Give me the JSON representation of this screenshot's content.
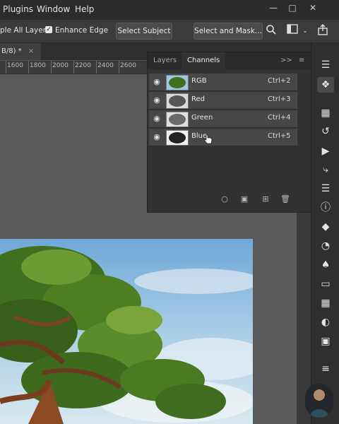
{
  "menubar": {
    "items": [
      "Plugins",
      "Window",
      "Help"
    ],
    "window_controls": [
      "minimize-icon",
      "maximize-icon",
      "close-icon"
    ]
  },
  "options_bar": {
    "sample_all_layers": "ple All Layers",
    "enhance_edge": "Enhance Edge",
    "enhance_edge_checked": true,
    "select_subject": "Select Subject",
    "select_and_mask": "Select and Mask...",
    "icons": [
      "search-icon",
      "workspace-icon",
      "chevron-down-icon",
      "share-icon"
    ]
  },
  "document_tab": {
    "label": "B/8) *",
    "close": "×"
  },
  "ruler": {
    "ticks": [
      "1600",
      "1800",
      "2000",
      "2200",
      "2400",
      "2600"
    ]
  },
  "panel": {
    "tabs": [
      "Layers",
      "Channels"
    ],
    "active_tab": "Channels",
    "collapse": ">>",
    "menu": "≡",
    "channels": [
      {
        "name": "RGB",
        "shortcut": "Ctrl+2"
      },
      {
        "name": "Red",
        "shortcut": "Ctrl+3"
      },
      {
        "name": "Green",
        "shortcut": "Ctrl+4"
      },
      {
        "name": "Blue",
        "shortcut": "Ctrl+5"
      }
    ],
    "footer_icons": [
      "load-selection-icon",
      "save-selection-icon",
      "new-channel-icon",
      "delete-channel-icon"
    ]
  },
  "toolbar": {
    "tools": [
      "layers-icon",
      "channels-icon",
      "swatches-grid-icon",
      "history-icon",
      "play-icon",
      "paths-icon",
      "adjustments-icon",
      "info-icon",
      "shapes-icon",
      "color-icon",
      "stamp-icon",
      "gradient-icon",
      "patterns-icon",
      "brush-settings-icon",
      "libraries-icon",
      "properties-icon"
    ]
  },
  "colors": {
    "canvas": "#5a5a5a",
    "panel": "#323232",
    "row": "#474747",
    "menubar": "#2b2b2b"
  }
}
